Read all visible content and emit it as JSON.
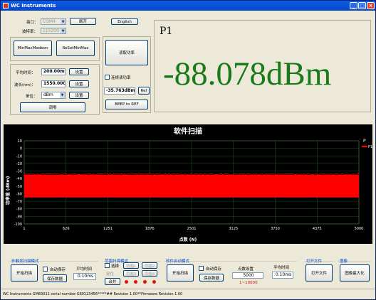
{
  "window": {
    "title": "WC Instruments"
  },
  "serial": {
    "port_label": "串口：",
    "port_value": "COM4",
    "baud_label": "波特率：",
    "baud_value": "115200",
    "disconnect": "断开",
    "language": "English"
  },
  "minmax": {
    "btn1": "MinMaxModeon",
    "btn2": "ReSetMinMax"
  },
  "power": {
    "read_btn": "读取功率",
    "continuous_label": "连续读功率",
    "ref_value": "-35.763dBm",
    "ref_btn": "Ref",
    "beep_btn": "BEEP to REF",
    "label": "P1",
    "reading": "-88.078dBm"
  },
  "params": {
    "avg_label": "平均时间：",
    "avg_value": "200.00ms",
    "avg_set": "设置",
    "wl_label": "波长(nm)：",
    "wl_value": "1550.000",
    "wl_set": "设置",
    "unit_label": "单位：",
    "unit_value": "dBm",
    "unit_set": "设置",
    "zero_btn": "调零"
  },
  "chart_data": {
    "type": "area",
    "title": "软件扫描",
    "xlabel": "点数 (N)",
    "ylabel": "功率值 (dBm)",
    "xlim": [
      1,
      5000
    ],
    "ylim": [
      -100,
      10
    ],
    "x_ticks": [
      "1",
      "626",
      "1251",
      "1876",
      "2501",
      "3125",
      "3750",
      "4375",
      "5000"
    ],
    "y_ticks": [
      "10",
      "0",
      "-10",
      "-20",
      "-30",
      "-40",
      "-50",
      "-60",
      "-70",
      "-80",
      "-90",
      "-100"
    ],
    "legend_title": "P",
    "grid": true,
    "legend_position": "top-right",
    "series": [
      {
        "name": "P1",
        "color": "#ff0000",
        "upper": -35,
        "lower": -65
      }
    ]
  },
  "bottom": {
    "ext": {
      "title": "外触发扫描模式",
      "start": "开始扫描",
      "auto_save": "自动保存",
      "save": "保存数据",
      "avg_label": "平均时间",
      "avg_value": "0.10ms"
    },
    "range": {
      "title": "范围扫描模式",
      "select": "选择",
      "range1": "范围1",
      "range2": "范围2",
      "reset": "复位",
      "range3": "范围3",
      "range4": "范围4",
      "merge": "合并"
    },
    "soft": {
      "title": "软件启动模式",
      "start": "开始扫描",
      "auto_save": "自动保存",
      "save": "保存数据",
      "points_label": "点数设置",
      "points_value": "5000",
      "points_range": "1~10000",
      "avg_label": "平均时间",
      "avg_value": "0.10ms"
    },
    "file": {
      "title": "打开文件",
      "open": "打开文件"
    },
    "image": {
      "title": "图像",
      "maximize": "图像最大化"
    }
  },
  "status": "WC Instruments GM83011 serial number:G60123456*****## Revision 1.00**Firmware Revision 1.00"
}
